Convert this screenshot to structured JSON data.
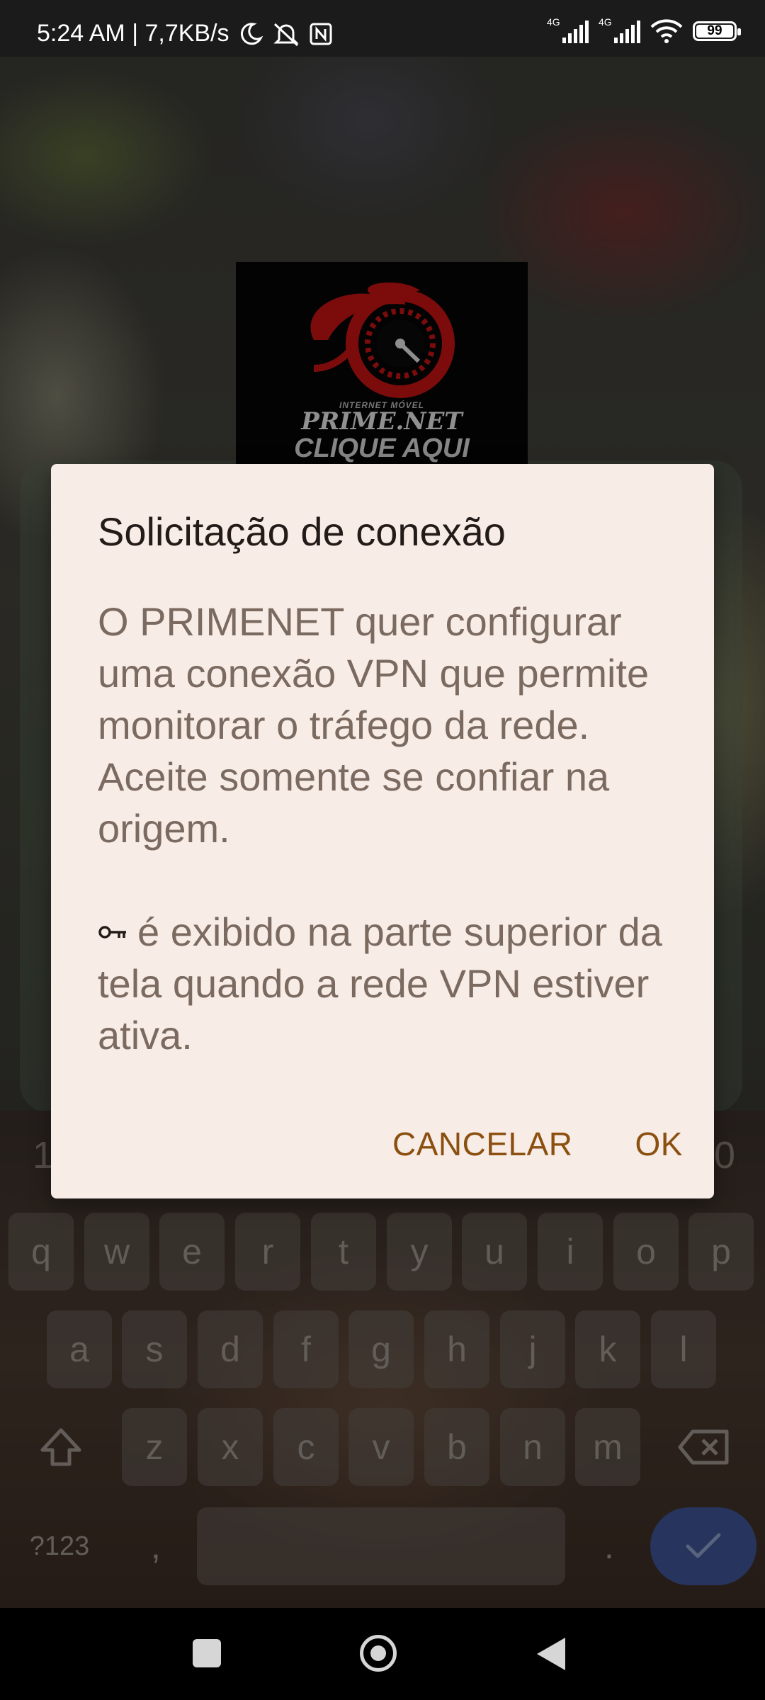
{
  "status_bar": {
    "time_and_speed": "5:24 AM | 7,7KB/s",
    "network1_label": "4G",
    "network2_label": "4G",
    "battery_level": "99"
  },
  "background_app": {
    "logo_tagline": "INTERNET MÓVEL",
    "logo_name": "PRIME.NET",
    "logo_cta": "CLIQUE AQUI",
    "number_row_peek_left": "1",
    "number_row_peek_right": "0"
  },
  "dialog": {
    "title": "Solicitação de conexão",
    "body_paragraph1": "O PRIMENET quer configurar uma conexão VPN que permite monitorar o tráfego da rede. Aceite somente se confiar na origem.",
    "body_paragraph2": "é exibido na parte superior da tela quando a rede VPN estiver ativa.",
    "key_icon": "vpn-key-icon",
    "cancel_label": "CANCELAR",
    "ok_label": "OK"
  },
  "keyboard": {
    "row1": [
      "q",
      "w",
      "e",
      "r",
      "t",
      "y",
      "u",
      "i",
      "o",
      "p"
    ],
    "row2": [
      "a",
      "s",
      "d",
      "f",
      "g",
      "h",
      "j",
      "k",
      "l"
    ],
    "row3": [
      "z",
      "x",
      "c",
      "v",
      "b",
      "n",
      "m"
    ],
    "symbols_label": "?123",
    "comma_label": ",",
    "period_label": "."
  },
  "colors": {
    "dialog_bg": "#f8ece6",
    "button_text": "#8b4f10",
    "enter_key": "#3f5596"
  }
}
